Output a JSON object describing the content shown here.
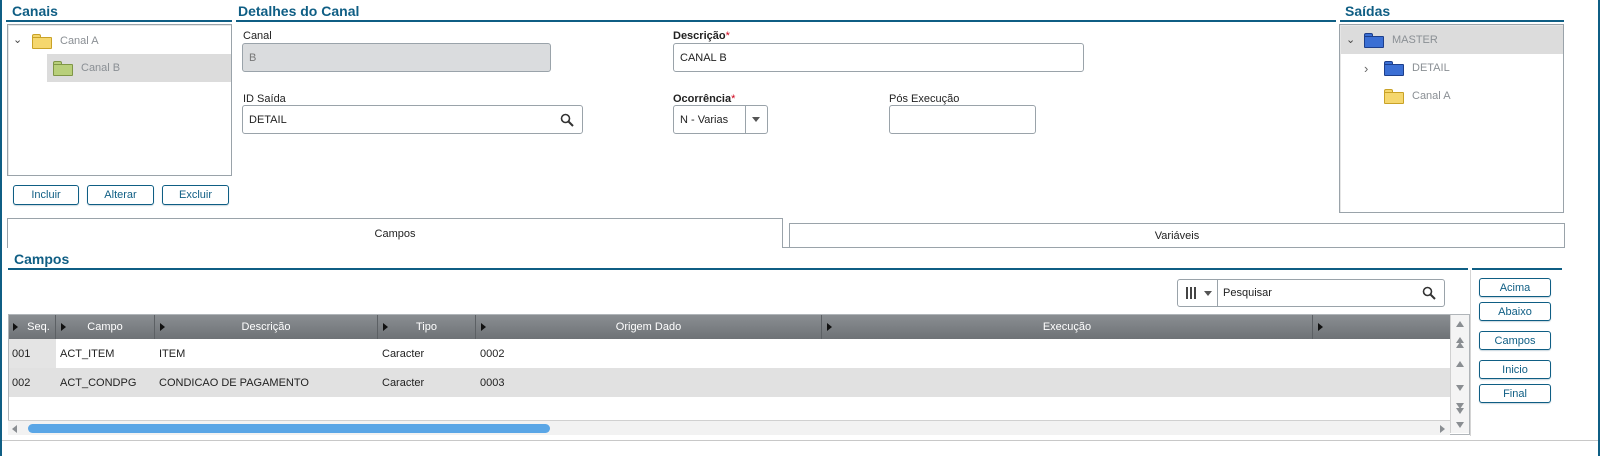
{
  "canais": {
    "title": "Canais",
    "tree": [
      {
        "label": "Canal A",
        "expanded": true
      },
      {
        "label": "Canal B",
        "selected": true
      }
    ],
    "buttons": {
      "incluir": "Incluir",
      "alterar": "Alterar",
      "excluir": "Excluir"
    }
  },
  "detalhes": {
    "title": "Detalhes do Canal",
    "canal_label": "Canal",
    "canal_value": "B",
    "descricao_label": "Descrição",
    "descricao_value": "CANAL B",
    "required_mark": "*",
    "id_saida_label": "ID Saída",
    "id_saida_value": "DETAIL",
    "ocorrencia_label": "Ocorrência",
    "ocorrencia_value": "N - Varias",
    "pos_execucao_label": "Pós Execução",
    "pos_execucao_value": ""
  },
  "saidas": {
    "title": "Saídas",
    "tree": [
      {
        "label": "MASTER",
        "expanded": true,
        "selected": true
      },
      {
        "label": "DETAIL",
        "expanded": false
      },
      {
        "label": "Canal A"
      }
    ]
  },
  "tabs": [
    {
      "label": "Campos",
      "active": true
    },
    {
      "label": "Variáveis",
      "active": false
    }
  ],
  "campos": {
    "title": "Campos",
    "search_placeholder": "Pesquisar",
    "columns": [
      "Seq.",
      "Campo",
      "Descrição",
      "Tipo",
      "Origem Dado",
      "Execução"
    ],
    "rows": [
      {
        "seq": "001",
        "campo": "ACT_ITEM",
        "descricao": "ITEM",
        "tipo": "Caracter",
        "origem": "0002",
        "execucao": ""
      },
      {
        "seq": "002",
        "campo": "ACT_CONDPG",
        "descricao": "CONDICAO DE PAGAMENTO",
        "tipo": "Caracter",
        "origem": "0003",
        "execucao": ""
      }
    ],
    "side_buttons": {
      "acima": "Acima",
      "abaixo": "Abaixo",
      "campos": "Campos",
      "inicio": "Inicio",
      "final": "Final"
    }
  },
  "colors": {
    "accent": "#0f5e84",
    "selected_row": "#e1e1e1",
    "folder_yellow": "#f5d76e",
    "folder_green": "#b8cf7a",
    "folder_blue": "#3b6fd4"
  }
}
